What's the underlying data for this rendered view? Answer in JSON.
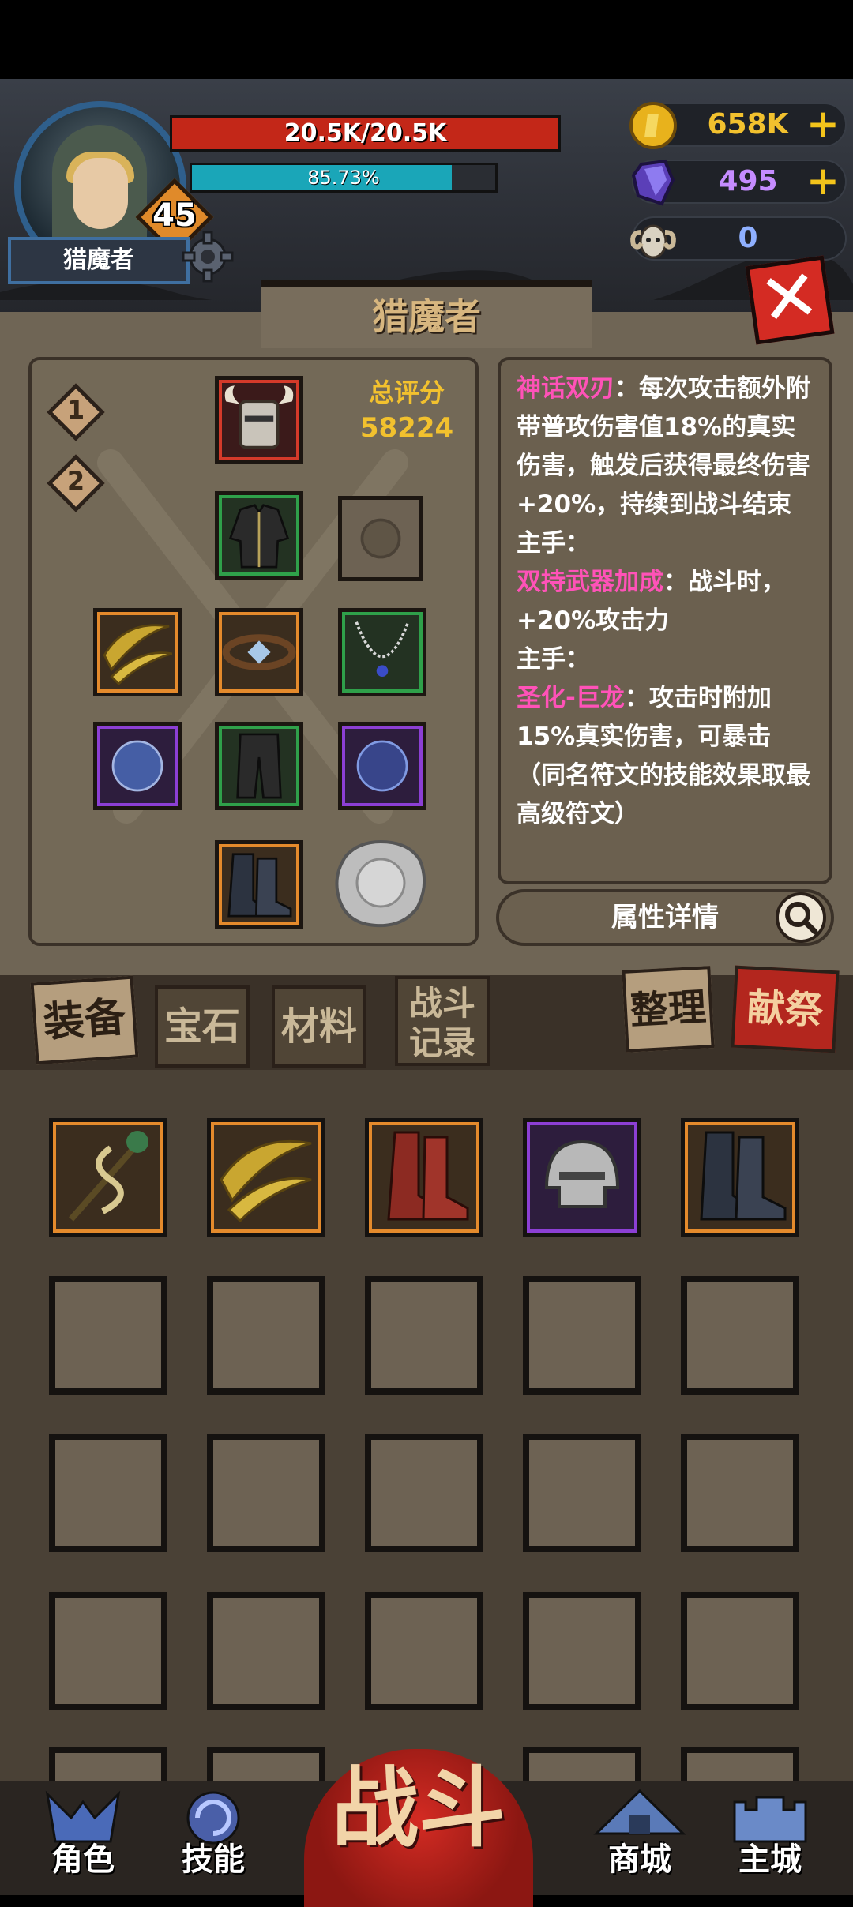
{
  "player": {
    "name": "猎魔者",
    "level": "45",
    "hp_text": "20.5K/20.5K",
    "hp_ratio": 1.0,
    "xp_text": "85.73%",
    "xp_ratio": 0.8573
  },
  "currencies": [
    {
      "icon": "gold-coin-icon",
      "value": "658K",
      "color": "#f2c12e",
      "has_plus": true
    },
    {
      "icon": "purple-crystal-icon",
      "value": "495",
      "color": "#c58cff",
      "has_plus": true
    },
    {
      "icon": "ram-skull-icon",
      "value": "0",
      "color": "#8fb0ff",
      "has_plus": false
    }
  ],
  "panel": {
    "title": "猎魔者",
    "score_label": "总评分",
    "score_value": "58224",
    "pages": [
      "1",
      "2"
    ],
    "attr_button": "属性详情"
  },
  "description": [
    {
      "highlight": "神话双刃",
      "text": "：每次攻击额外附带普攻伤害值18%的真实伤害，触发后获得最终伤害+20%，持续到战斗结束"
    },
    {
      "highlight": "",
      "text": "主手："
    },
    {
      "highlight": "双持武器加成",
      "text": "：战斗时，+20%攻击力"
    },
    {
      "highlight": "",
      "text": "主手："
    },
    {
      "highlight": "圣化-巨龙",
      "text": "：攻击时附加15%真实伤害，可暴击（同名符文的技能效果取最高级符文）"
    }
  ],
  "equipment_slots": [
    {
      "name": "helmet-slot",
      "rarity": "red",
      "icon": "horned-helmet-icon"
    },
    {
      "name": "armor-slot",
      "rarity": "green",
      "icon": "jacket-icon"
    },
    {
      "name": "offhand-slot",
      "rarity": "empty",
      "icon": "locked-slot-icon"
    },
    {
      "name": "mainhand-slot",
      "rarity": "gold",
      "icon": "twin-blade-icon"
    },
    {
      "name": "belt-slot",
      "rarity": "gold",
      "icon": "belt-icon"
    },
    {
      "name": "necklace-slot",
      "rarity": "green",
      "icon": "necklace-icon"
    },
    {
      "name": "ring-left-slot",
      "rarity": "purple",
      "icon": "crystal-ring-icon"
    },
    {
      "name": "pants-slot",
      "rarity": "green",
      "icon": "pants-icon"
    },
    {
      "name": "ring-right-slot",
      "rarity": "purple",
      "icon": "crystal-ring-icon"
    },
    {
      "name": "boots-slot",
      "rarity": "gold",
      "icon": "boots-icon"
    },
    {
      "name": "seal-slot",
      "rarity": "empty",
      "icon": "wax-seal-icon"
    }
  ],
  "tabs": [
    {
      "id": "equipment",
      "label": "装备",
      "active": true
    },
    {
      "id": "gems",
      "label": "宝石",
      "active": false
    },
    {
      "id": "materials",
      "label": "材料",
      "active": false
    },
    {
      "id": "battle-log",
      "label": "战斗记录",
      "active": false
    },
    {
      "id": "sort",
      "label": "整理",
      "active": false
    },
    {
      "id": "sacrifice",
      "label": "献祭",
      "active": false
    }
  ],
  "inventory": [
    {
      "icon": "serpent-staff-icon",
      "rarity": "gold"
    },
    {
      "icon": "twin-blade-icon",
      "rarity": "gold"
    },
    {
      "icon": "red-boots-icon",
      "rarity": "gold"
    },
    {
      "icon": "steel-helmet-icon",
      "rarity": "purple"
    },
    {
      "icon": "boots-icon",
      "rarity": "gold"
    }
  ],
  "bottom_nav": [
    {
      "id": "character",
      "label": "角色",
      "icon": "helmet-crest-icon"
    },
    {
      "id": "skills",
      "label": "技能",
      "icon": "swirl-icon"
    },
    {
      "id": "battle",
      "label": "战斗",
      "icon": ""
    },
    {
      "id": "shop",
      "label": "商城",
      "icon": "tent-icon"
    },
    {
      "id": "city",
      "label": "主城",
      "icon": "castle-icon"
    }
  ]
}
